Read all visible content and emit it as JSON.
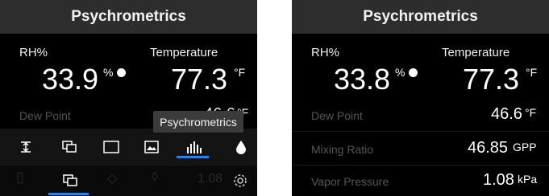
{
  "left": {
    "title": "Psychrometrics",
    "rh": {
      "label": "RH%",
      "value": "33.9",
      "unit": "%"
    },
    "temp": {
      "label": "Temperature",
      "value": "77.3",
      "unit": "°F"
    },
    "dew_point": {
      "label": "Dew Point",
      "value": "46.6",
      "unit": "°F"
    },
    "tooltip": "Psychrometrics",
    "toolbar": [
      "range-icon",
      "copy-icon",
      "square-icon",
      "image-icon",
      "bar-chart-icon",
      "droplet-icon"
    ],
    "bottombar": [
      "copy-icon",
      "settings-icon"
    ],
    "ghost_value": "1.08"
  },
  "right": {
    "title": "Psychrometrics",
    "rh": {
      "label": "RH%",
      "value": "33.8",
      "unit": "%"
    },
    "temp": {
      "label": "Temperature",
      "value": "77.3",
      "unit": "°F"
    },
    "dew_point": {
      "label": "Dew Point",
      "value": "46.6",
      "unit": "°F"
    },
    "mixing_ratio": {
      "label": "Mixing Ratio",
      "value": "46.85",
      "unit": "GPP"
    },
    "vapor_pressure": {
      "label": "Vapor Pressure",
      "value": "1.08",
      "unit": "kPa"
    }
  },
  "colors": {
    "accent": "#2a82e4",
    "background": "#000000",
    "titlebar": "#2d2d2d"
  }
}
